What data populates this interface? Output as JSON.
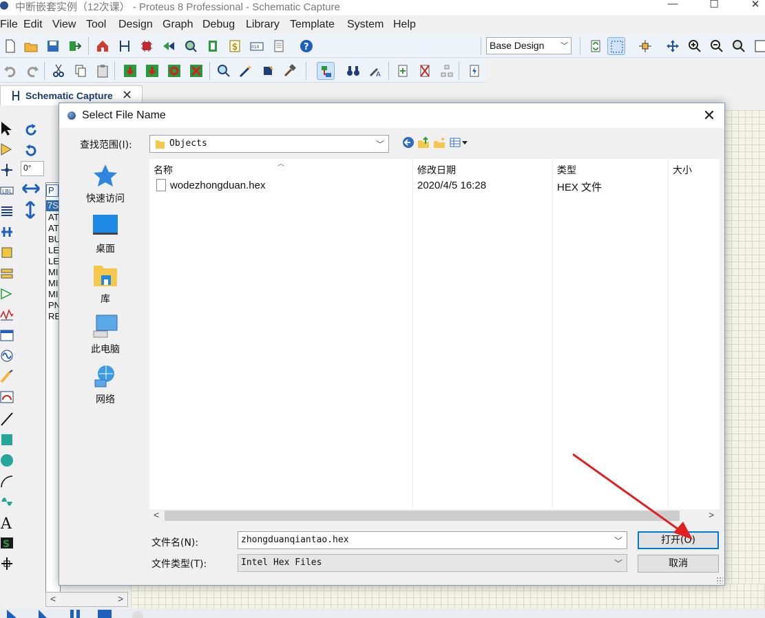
{
  "window": {
    "title": "中断嵌套实例（12次课） - Proteus 8 Professional - Schematic Capture",
    "minimize": "—",
    "maximize": "☐",
    "close": "✕"
  },
  "menu": [
    "File",
    "Edit",
    "View",
    "Tool",
    "Design",
    "Graph",
    "Debug",
    "Library",
    "Template",
    "System",
    "Help"
  ],
  "toolbar": {
    "design_select": "Base Design"
  },
  "tab": {
    "label": "Schematic Capture",
    "close": "✕"
  },
  "rotation": {
    "angle": "0°"
  },
  "device_list": {
    "header": "P",
    "selected": "7S",
    "items": [
      "AT",
      "AT",
      "BU",
      "LE",
      "LE",
      "MI",
      "MI",
      "MI",
      "PN",
      "RE"
    ]
  },
  "dialog": {
    "title": "Select File Name",
    "look_in_label": "查找范围(I):",
    "look_in_value": "Objects",
    "places": [
      {
        "label": "快速访问",
        "icon": "star-icon"
      },
      {
        "label": "桌面",
        "icon": "desktop-icon"
      },
      {
        "label": "库",
        "icon": "library-folder-icon"
      },
      {
        "label": "此电脑",
        "icon": "computer-icon"
      },
      {
        "label": "网络",
        "icon": "network-icon"
      }
    ],
    "columns": [
      "名称",
      "修改日期",
      "类型",
      "大小"
    ],
    "files": [
      {
        "name": "wodezhongduan.hex",
        "modified": "2020/4/5 16:28",
        "type": "HEX 文件",
        "size": ""
      }
    ],
    "filename_label": "文件名(N):",
    "filename_value": "zhongduanqiantao.hex",
    "filetype_label": "文件类型(T):",
    "filetype_value": "Intel Hex Files",
    "open_button": "打开(O)",
    "cancel_button": "取消"
  },
  "colors": {
    "accent": "#0078d7",
    "annotation_arrow": "#e02020",
    "canvas": "#f4f4e6"
  }
}
